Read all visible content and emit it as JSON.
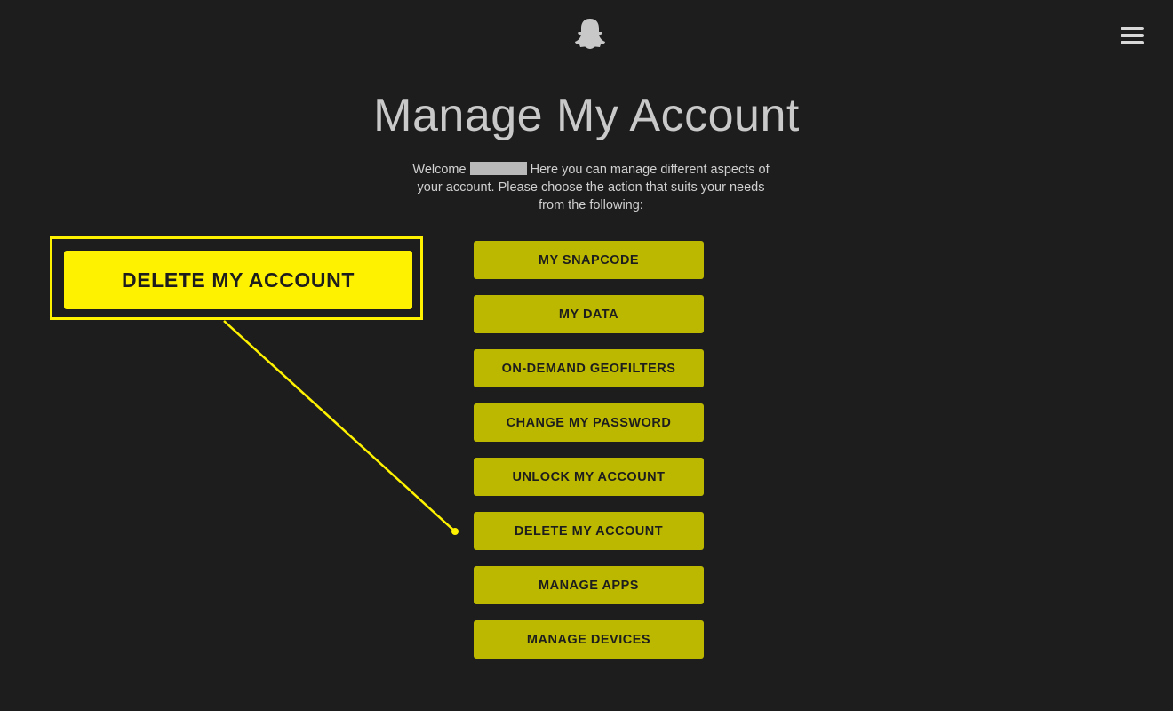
{
  "header": {
    "logo_icon": "snapchat-ghost-icon",
    "menu_icon": "hamburger-menu-icon"
  },
  "main": {
    "title": "Manage My Account",
    "intro_welcome": "Welcome",
    "intro_rest": "Here you can manage different aspects of your account. Please choose the action that suits your needs from the following:",
    "buttons": [
      {
        "label": "MY SNAPCODE"
      },
      {
        "label": "MY DATA"
      },
      {
        "label": "ON-DEMAND GEOFILTERS"
      },
      {
        "label": "CHANGE MY PASSWORD"
      },
      {
        "label": "UNLOCK MY ACCOUNT"
      },
      {
        "label": "DELETE MY ACCOUNT"
      },
      {
        "label": "MANAGE APPS"
      },
      {
        "label": "MANAGE DEVICES"
      }
    ]
  },
  "callout": {
    "label": "DELETE MY ACCOUNT",
    "color": "#fff200"
  },
  "colors": {
    "background": "#1d1d1d",
    "button": "#bcb800",
    "highlight": "#fff200"
  }
}
